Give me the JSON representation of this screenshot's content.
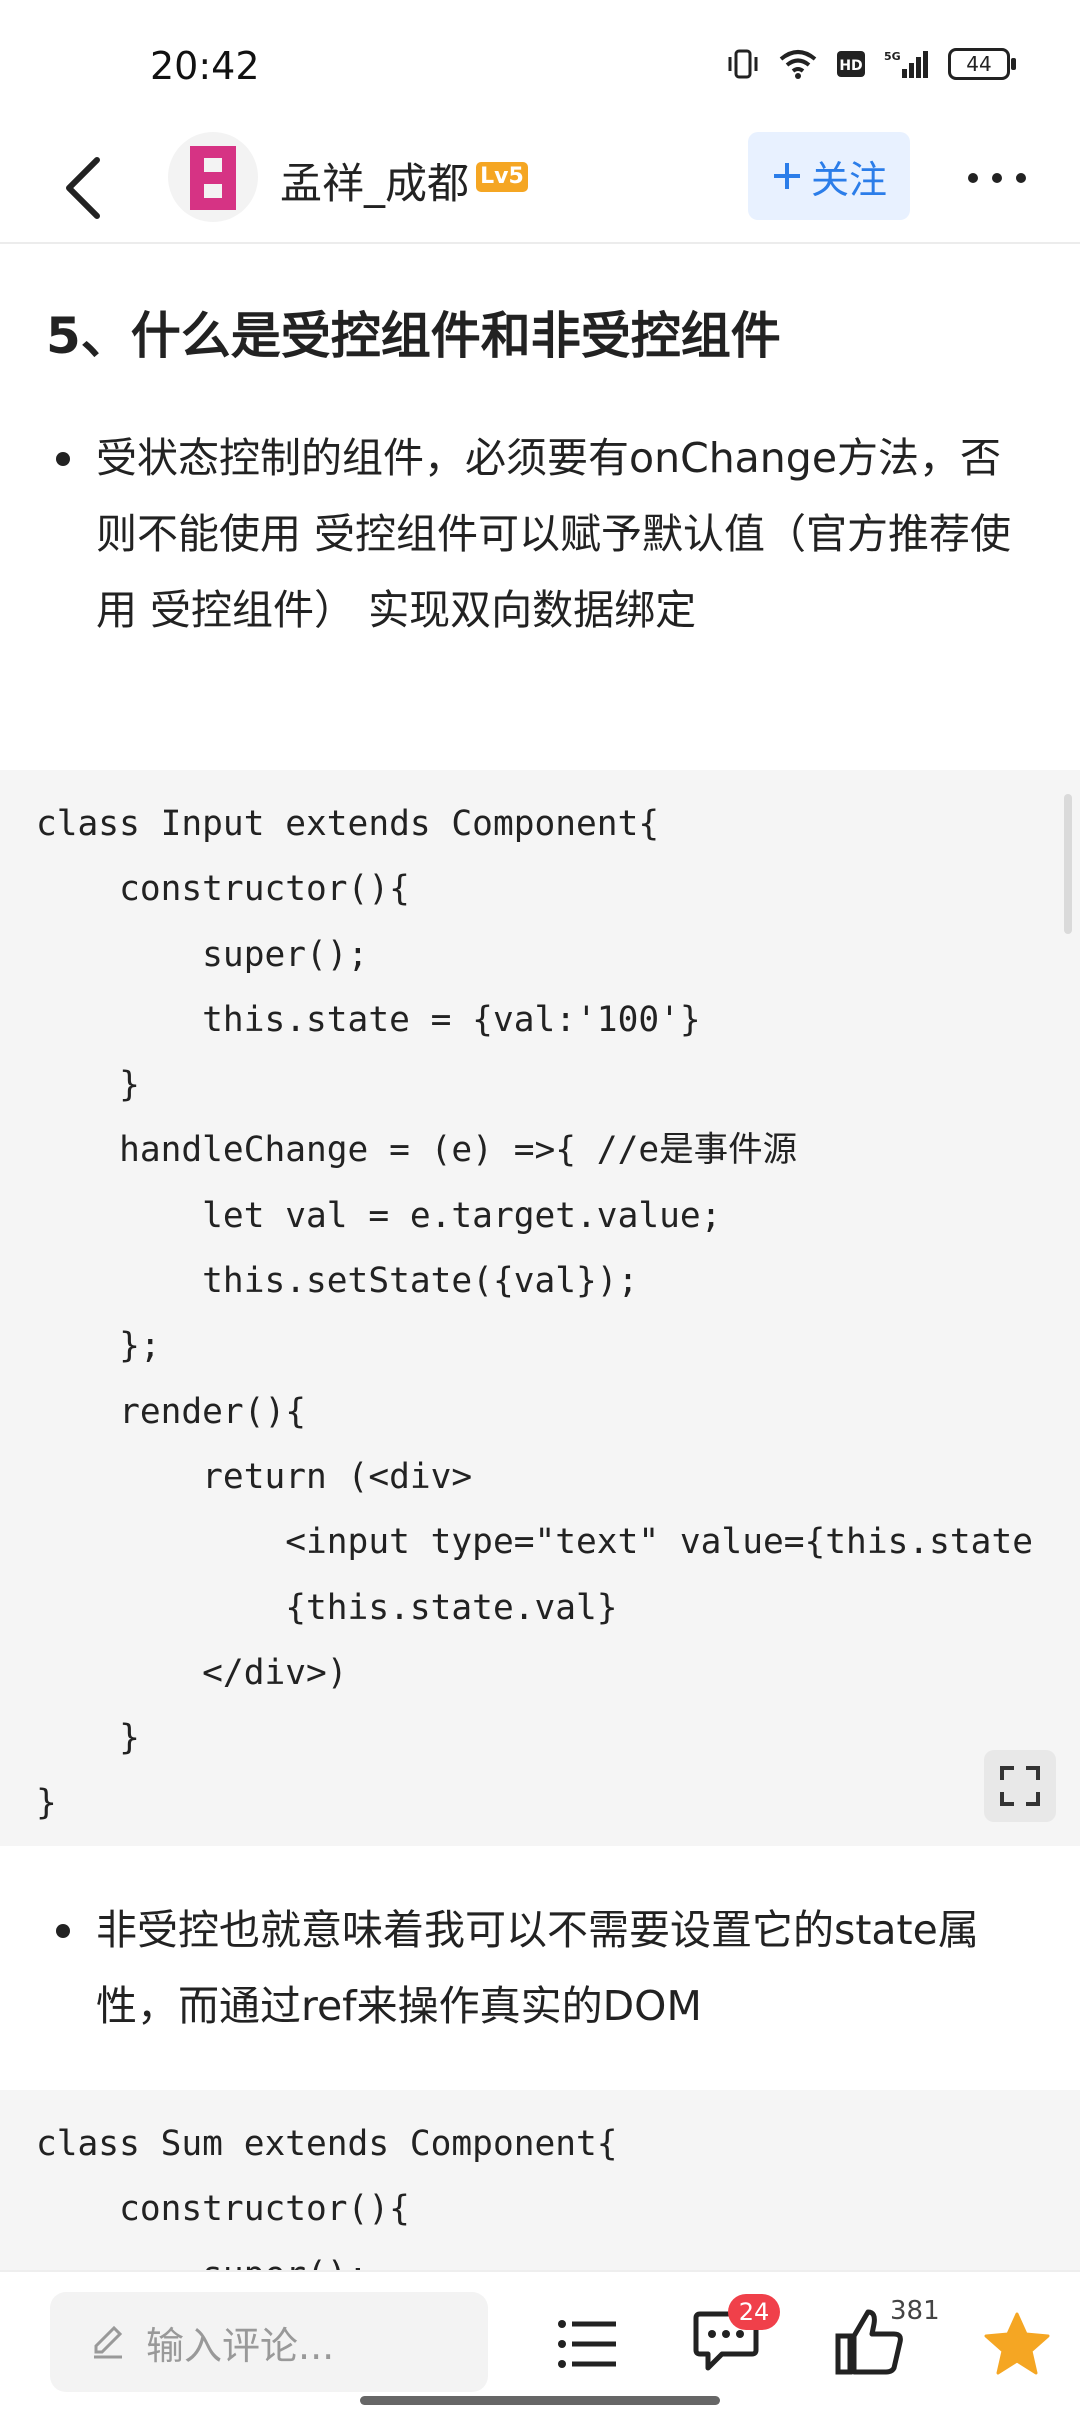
{
  "status_bar": {
    "time": "20:42",
    "battery": "44"
  },
  "header": {
    "username": "孟祥_成都",
    "level": "Lv5",
    "follow_label": "关注"
  },
  "article": {
    "section_title": "5、什么是受控组件和非受控组件",
    "bullet_1": "受状态控制的组件，必须要有onChange方法，否则不能使用 受控组件可以赋予默认值（官方推荐使用 受控组件） 实现双向数据绑定",
    "code_1": [
      "class Input extends Component{",
      "    constructor(){",
      "        super();",
      "        this.state = {val:'100'}",
      "    }",
      "    handleChange = (e) =>{ //e是事件源",
      "        let val = e.target.value;",
      "        this.setState({val});",
      "    };",
      "    render(){",
      "        return (<div>",
      "            <input type=\"text\" value={this.state",
      "            {this.state.val}",
      "        </div>)",
      "    }",
      "}"
    ],
    "bullet_2": "非受控也就意味着我可以不需要设置它的state属性，而通过ref来操作真实的DOM",
    "code_2": [
      "class Sum extends Component{",
      "    constructor(){",
      "        super();"
    ]
  },
  "bottom_bar": {
    "comment_placeholder": "输入评论...",
    "message_badge": "24",
    "like_count": "381"
  },
  "colors": {
    "accent": "#2b7de9",
    "badge": "#f0404a",
    "star": "#f5a623",
    "level": "#f5a623"
  }
}
